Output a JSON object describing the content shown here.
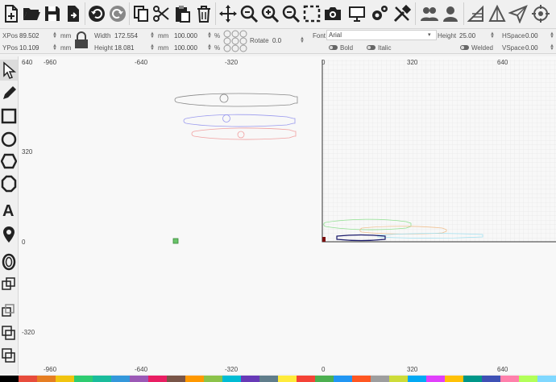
{
  "toolbar": {
    "buttons": [
      "new-icon",
      "open-icon",
      "save-icon",
      "export-icon",
      "undo-icon",
      "redo-icon",
      "copy-icon",
      "cut-icon",
      "paste-icon",
      "delete-icon",
      "move-icon",
      "zoom-fit-icon",
      "zoom-in-icon",
      "zoom-out-icon",
      "select-box-icon",
      "camera-icon",
      "monitor-icon",
      "settings-icon",
      "tools-icon",
      "users-icon",
      "user-icon",
      "mirror-h-icon",
      "mirror-v-icon",
      "send-icon",
      "target-icon"
    ]
  },
  "props": {
    "xpos_label": "XPos",
    "xpos_value": "89.502",
    "xpos_unit": "mm",
    "ypos_label": "YPos",
    "ypos_value": "10.109",
    "ypos_unit": "mm",
    "width_label": "Width",
    "width_value": "172.554",
    "width_unit": "mm",
    "width_pct": "100.000",
    "pct": "%",
    "height_label": "Height",
    "height_value": "18.081",
    "height_unit": "mm",
    "height_pct": "100.000",
    "rotate_label": "Rotate",
    "rotate_value": "0.0",
    "font_label": "Font",
    "font_value": "Arial",
    "fheight_label": "Height",
    "fheight_value": "25.00",
    "hspace_label": "HSpace",
    "hspace_value": "0.00",
    "vspace_label": "VSpace",
    "vspace_value": "0.00",
    "bold_label": "Bold",
    "italic_label": "Italic",
    "welded_label": "Welded"
  },
  "left_tools": [
    "pointer-icon",
    "pencil-icon",
    "rectangle-icon",
    "circle-icon",
    "hexagon-icon",
    "octagon-icon",
    "text-icon",
    "location-pin-icon",
    "offset-icon",
    "union-icon",
    "subtract-icon",
    "intersect-icon",
    "xor-icon"
  ],
  "axes": {
    "x_ticks": [
      "-960",
      "-640",
      "-320",
      "0",
      "320",
      "640"
    ],
    "y_ticks": [
      "640",
      "320",
      "0",
      "-320"
    ]
  },
  "colors": {
    "accent": "#1a1a1a",
    "grid": "#dddddd",
    "workarea_border": "#333333"
  },
  "palette": [
    "#000000",
    "#e74c3c",
    "#e67e22",
    "#f1c40f",
    "#2ecc71",
    "#1abc9c",
    "#3498db",
    "#9b59b6",
    "#e91e63",
    "#795548",
    "#ff9800",
    "#8bc34a",
    "#00bcd4",
    "#673ab7",
    "#607d8b",
    "#ffeb3b",
    "#f44336",
    "#4caf50",
    "#2196f3",
    "#ff5722",
    "#9e9e9e",
    "#cddc39",
    "#03a9f4",
    "#e040fb",
    "#ffc107",
    "#009688",
    "#3f51b5",
    "#ff80ab",
    "#b2ff59",
    "#80d8ff"
  ]
}
